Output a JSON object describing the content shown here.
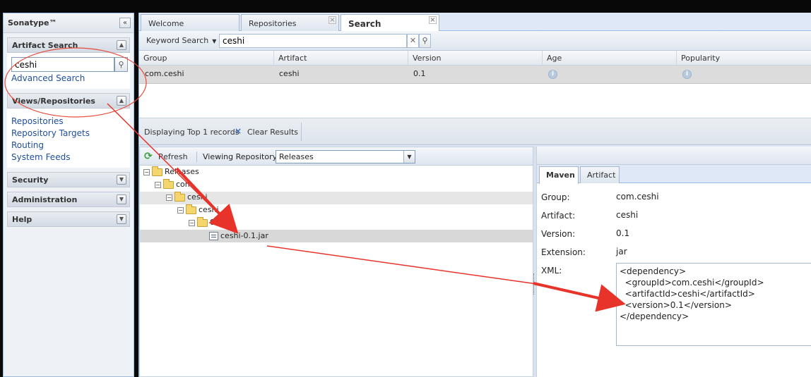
{
  "brand": "Sonatype™",
  "left": {
    "artifact_search": {
      "title": "Artifact Search",
      "query": "ceshi",
      "advanced_link": "Advanced Search"
    },
    "views": {
      "title": "Views/Repositories",
      "links": [
        "Repositories",
        "Repository Targets",
        "Routing",
        "System Feeds"
      ]
    },
    "security": {
      "title": "Security"
    },
    "administration": {
      "title": "Administration"
    },
    "help": {
      "title": "Help"
    }
  },
  "tabs": [
    "Welcome",
    "Repositories",
    "Search"
  ],
  "toolbar": {
    "search_mode": "Keyword Search",
    "query": "ceshi"
  },
  "grid": {
    "columns": [
      "Group",
      "Artifact",
      "Version",
      "Age",
      "Popularity"
    ],
    "rows": [
      {
        "group": "com.ceshi",
        "artifact": "ceshi",
        "version": "0.1"
      }
    ]
  },
  "status": {
    "displaying": "Displaying Top 1 records",
    "clear": "Clear Results"
  },
  "tree_toolbar": {
    "refresh": "Refresh",
    "viewing_label": "Viewing Repository:",
    "repo": "Releases"
  },
  "tree": {
    "root": "Releases",
    "n1": "com",
    "n2": "ceshi",
    "n3": "ceshi",
    "n4": "0.1",
    "file": "ceshi-0.1.jar"
  },
  "detail": {
    "tabs": [
      "Maven",
      "Artifact"
    ],
    "labels": {
      "group": "Group:",
      "artifact": "Artifact:",
      "version": "Version:",
      "extension": "Extension:",
      "xml": "XML:"
    },
    "values": {
      "group": "com.ceshi",
      "artifact": "ceshi",
      "version": "0.1",
      "extension": "jar"
    },
    "xml_lines": [
      "<dependency>",
      "  <groupId>com.ceshi</groupId>",
      "  <artifactId>ceshi</artifactId>",
      "  <version>0.1</version>",
      "</dependency>"
    ]
  }
}
